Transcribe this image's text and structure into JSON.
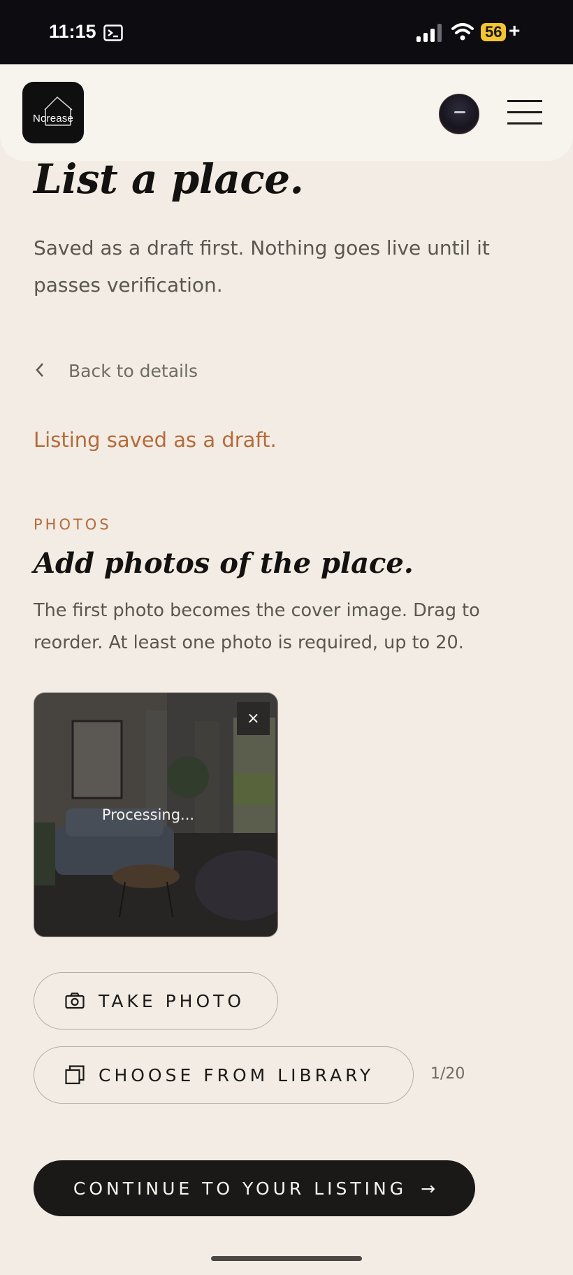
{
  "status_bar": {
    "time": "11:15",
    "battery": "56",
    "battery_suffix": "+",
    "icons": [
      "terminal-icon",
      "signal-icon",
      "wifi-icon"
    ]
  },
  "header": {
    "logo_text_left": "Nor",
    "logo_text_right": "ease",
    "menu_icon": "hamburger-menu-icon"
  },
  "page": {
    "title": "List a place.",
    "subtitle": "Saved as a draft first. Nothing goes live until it passes verification.",
    "back_label": "Back to details",
    "draft_notice": "Listing saved as a draft."
  },
  "photos": {
    "eyebrow": "PHOTOS",
    "title": "Add photos of the place.",
    "description": "The first photo becomes the cover image. Drag to reorder. At least one photo is required, up to 20.",
    "items": [
      {
        "status": "Processing...",
        "remove_label": "×"
      }
    ],
    "take_photo_label": "TAKE PHOTO",
    "choose_library_label": "CHOOSE FROM LIBRARY",
    "count": "1/20"
  },
  "actions": {
    "continue_label": "CONTINUE TO YOUR LISTING",
    "continue_arrow": "→"
  },
  "colors": {
    "background": "#f2ece4",
    "accent": "#b66a3a",
    "primary_button": "#1a1918"
  }
}
